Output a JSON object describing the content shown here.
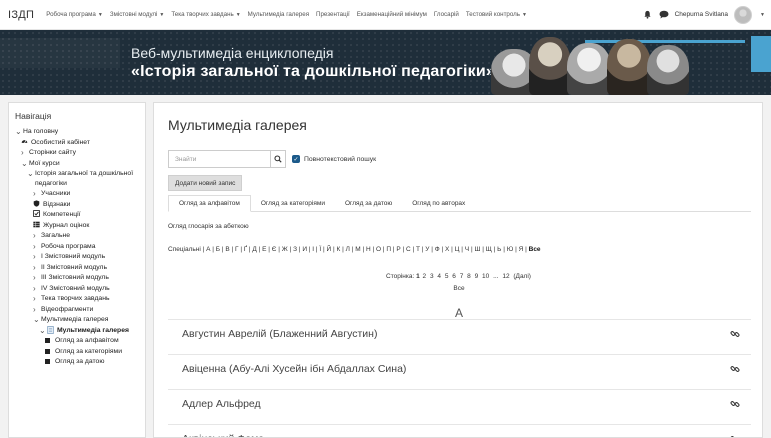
{
  "navbar": {
    "brand": "ІЗДП",
    "menu": [
      {
        "label": "Робоча програма",
        "dropdown": true
      },
      {
        "label": "Змістовні модулі",
        "dropdown": true
      },
      {
        "label": "Тека творчих завдань",
        "dropdown": true
      },
      {
        "label": "Мультимедіа галерея",
        "dropdown": false
      },
      {
        "label": "Презентації",
        "dropdown": false
      },
      {
        "label": "Екзаменаційний мінімум",
        "dropdown": false
      },
      {
        "label": "Глосарій",
        "dropdown": false
      },
      {
        "label": "Тестовий контроль",
        "dropdown": true
      }
    ],
    "user_name": "Chepurna Svitlana"
  },
  "banner": {
    "line1": "Веб-мультимедіа енциклопедія",
    "line2": "«Історія загальної та дошкільної педагогіки»"
  },
  "sidebar": {
    "heading": "Навігація",
    "items": [
      {
        "label": "На головну",
        "mark": "v",
        "icon": "",
        "indent": 0
      },
      {
        "label": "Особистий кабінет",
        "mark": "",
        "icon": "dashboard-icon",
        "indent": 1
      },
      {
        "label": "Сторінки сайту",
        "mark": ">",
        "icon": "",
        "indent": 1
      },
      {
        "label": "Мої курси",
        "mark": "v",
        "icon": "",
        "indent": 1
      },
      {
        "label": "Історія загальної та дошкільної педагогіки",
        "mark": "v",
        "icon": "",
        "indent": 2
      },
      {
        "label": "Учасники",
        "mark": ">",
        "icon": "",
        "indent": 3
      },
      {
        "label": "Відзнаки",
        "mark": "",
        "icon": "badge-icon",
        "indent": 3
      },
      {
        "label": "Компетенції",
        "mark": "",
        "icon": "checkbox-icon",
        "indent": 3
      },
      {
        "label": "Журнал оцінок",
        "mark": "",
        "icon": "table-icon",
        "indent": 3
      },
      {
        "label": "Загальне",
        "mark": ">",
        "icon": "",
        "indent": 3
      },
      {
        "label": "Робоча програма",
        "mark": ">",
        "icon": "",
        "indent": 3
      },
      {
        "label": "І Змістовний модуль",
        "mark": ">",
        "icon": "",
        "indent": 3
      },
      {
        "label": "ІІ Змістовний модуль",
        "mark": ">",
        "icon": "",
        "indent": 3
      },
      {
        "label": "ІІІ Змістовний модуль",
        "mark": ">",
        "icon": "",
        "indent": 3
      },
      {
        "label": "IV Змістовний модуль",
        "mark": ">",
        "icon": "",
        "indent": 3
      },
      {
        "label": "Тека творчих завдань",
        "mark": ">",
        "icon": "",
        "indent": 3
      },
      {
        "label": "Відеофрагменти",
        "mark": ">",
        "icon": "",
        "indent": 3
      },
      {
        "label": "Мультимедіа галерея",
        "mark": "v",
        "icon": "",
        "indent": 3
      },
      {
        "label": "Мультимедіа галерея",
        "mark": "v",
        "icon": "glossary-icon",
        "indent": 4,
        "active": true
      },
      {
        "label": "Огляд за алфавітом",
        "mark": "",
        "icon": "square-icon",
        "indent": 5
      },
      {
        "label": "Огляд за категоріями",
        "mark": "",
        "icon": "square-icon",
        "indent": 5
      },
      {
        "label": "Огляд за датою",
        "mark": "",
        "icon": "square-icon",
        "indent": 5
      }
    ]
  },
  "main": {
    "title": "Мультимедіа галерея",
    "search_placeholder": "Знайти",
    "fulltext_label": "Повнотекстовий пошук",
    "add_entry_label": "Додати новий запис",
    "tabs": [
      {
        "label": "Огляд за алфавітом",
        "active": true
      },
      {
        "label": "Огляд за категоріями",
        "active": false
      },
      {
        "label": "Огляд за датою",
        "active": false
      },
      {
        "label": "Огляд по авторах",
        "active": false
      }
    ],
    "subtitle": "Огляд глосарія за абеткою",
    "alphabet_prefix": "Спеціальні",
    "alphabet": [
      "А",
      "Б",
      "В",
      "Г",
      "Ґ",
      "Д",
      "Е",
      "Є",
      "Ж",
      "З",
      "И",
      "І",
      "Ї",
      "Й",
      "К",
      "Л",
      "М",
      "Н",
      "О",
      "П",
      "Р",
      "С",
      "Т",
      "У",
      "Ф",
      "Х",
      "Ц",
      "Ч",
      "Ш",
      "Щ",
      "Ь",
      "Ю",
      "Я"
    ],
    "alphabet_all": "Все",
    "pager": {
      "label": "Сторінка:",
      "current": "1",
      "pages": [
        "2",
        "3",
        "4",
        "5",
        "6",
        "7",
        "8",
        "9",
        "10",
        "...",
        "12"
      ],
      "next": "(Далі)",
      "all": "Все"
    },
    "section_letter": "А",
    "entries": [
      {
        "name": "Августин Аврелій (Блаженний Августин)"
      },
      {
        "name": "Авіценна (Абу-Алі Хусейн ібн Абдаллах Сина)"
      },
      {
        "name": "Адлер Альфред"
      },
      {
        "name": "Аквінський Фома"
      }
    ]
  }
}
